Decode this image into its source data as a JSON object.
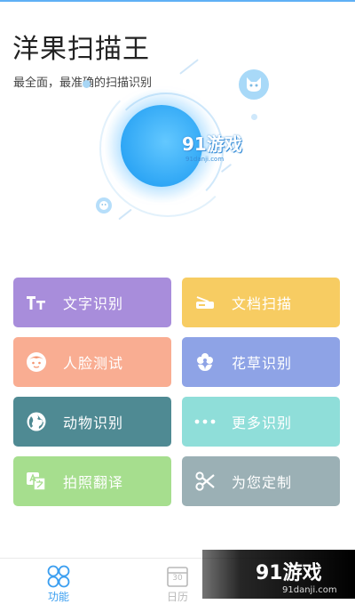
{
  "app": {
    "title": "洋果扫描王",
    "subtitle": "最全面，最准确的扫描识别"
  },
  "hero": {
    "logo_text": "91游戏",
    "logo_url": "91danji.com"
  },
  "features": [
    {
      "label": "文字识别",
      "icon": "text-tt-icon",
      "color": "#a88ddb"
    },
    {
      "label": "文档扫描",
      "icon": "scanner-icon",
      "color": "#f7cc62"
    },
    {
      "label": "人脸测试",
      "icon": "face-icon",
      "color": "#f9ad92"
    },
    {
      "label": "花草识别",
      "icon": "flower-icon",
      "color": "#8ea3e6"
    },
    {
      "label": "动物识别",
      "icon": "globe-icon",
      "color": "#4f8a93"
    },
    {
      "label": "更多识别",
      "icon": "more-dots-icon",
      "color": "#8fded9"
    },
    {
      "label": "拍照翻译",
      "icon": "translate-icon",
      "color": "#a6de8e"
    },
    {
      "label": "为您定制",
      "icon": "scissors-icon",
      "color": "#9bb0b5"
    }
  ],
  "tabs": [
    {
      "label": "功能",
      "icon": "grid-icon",
      "active": true
    },
    {
      "label": "日历",
      "icon": "calendar-icon",
      "active": false
    }
  ],
  "calendar_number": "30",
  "watermark": {
    "text": "91游戏",
    "url": "91danji.com"
  },
  "colors": {
    "accent": "#3a9ef0",
    "inactive": "#b9b9b9"
  }
}
